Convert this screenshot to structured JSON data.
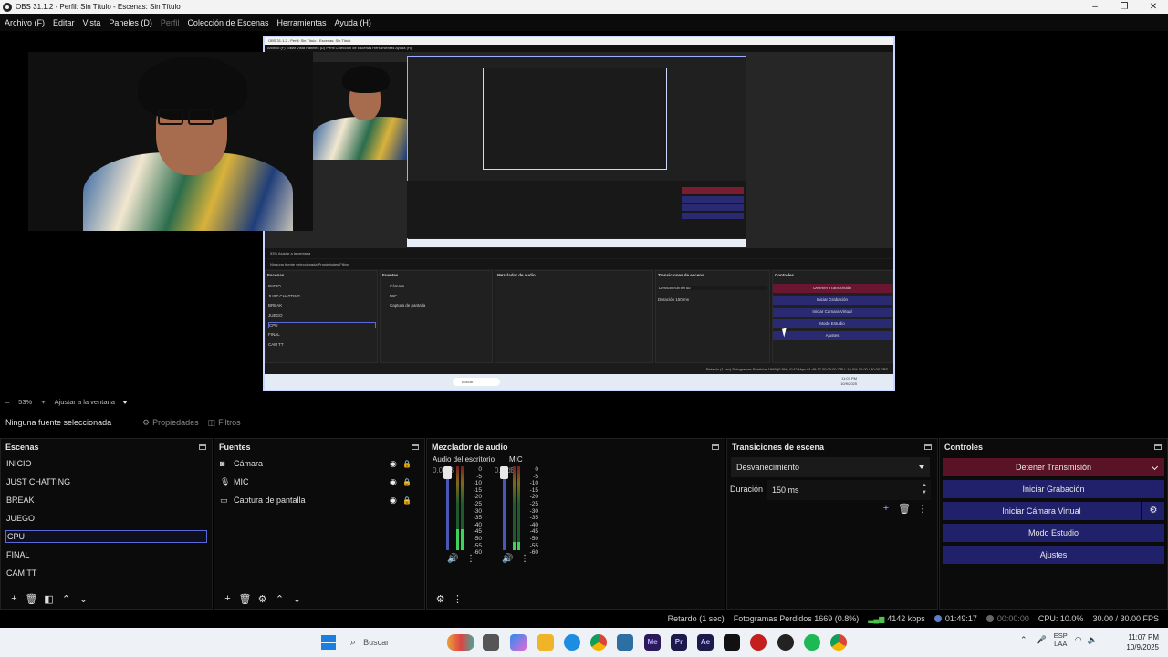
{
  "window": {
    "title": "OBS 31.1.2 - Perfil: Sin Título - Escenas: Sin Título",
    "minimize": "–",
    "maximize": "❐",
    "close": "✕"
  },
  "menu": [
    {
      "label": "Archivo (F)",
      "enabled": true
    },
    {
      "label": "Editar",
      "enabled": true
    },
    {
      "label": "Vista",
      "enabled": true
    },
    {
      "label": "Paneles (D)",
      "enabled": true
    },
    {
      "label": "Perfil",
      "enabled": false
    },
    {
      "label": "Colección de Escenas",
      "enabled": true
    },
    {
      "label": "Herramientas",
      "enabled": true
    },
    {
      "label": "Ayuda (H)",
      "enabled": true
    }
  ],
  "zoom": {
    "minus": "–",
    "value": "53%",
    "plus": "+",
    "fit": "Ajustar a la ventana"
  },
  "source_toolbar": {
    "no_source": "Ninguna fuente seleccionada",
    "properties": "Propiedades",
    "filters": "Filtros"
  },
  "scenes": {
    "title": "Escenas",
    "items": [
      "INICIO",
      "JUST CHATTING",
      "BREAK",
      "JUEGO",
      "CPU",
      "FINAL",
      "CAM TT"
    ],
    "selected": "CPU"
  },
  "sources": {
    "title": "Fuentes",
    "items": [
      {
        "name": "Cámara",
        "icon": "camera-icon"
      },
      {
        "name": "MIC",
        "icon": "microphone-icon"
      },
      {
        "name": "Captura de pantalla",
        "icon": "monitor-icon"
      }
    ]
  },
  "mixer": {
    "title": "Mezclador de audio",
    "channels": [
      {
        "name": "Audio del escritorio",
        "db": "0.0 dB",
        "level": 0.25
      },
      {
        "name": "MIC",
        "db": "0.0 dB",
        "level": 0.1
      }
    ],
    "scale": [
      "0",
      "-5",
      "-10",
      "-15",
      "-20",
      "-25",
      "-30",
      "-35",
      "-40",
      "-45",
      "-50",
      "-55",
      "-60"
    ]
  },
  "transitions": {
    "title": "Transiciones de escena",
    "selected": "Desvanecimiento",
    "duration_label": "Duración",
    "duration_value": "150 ms"
  },
  "controls": {
    "title": "Controles",
    "stop_stream": "Detener Transmisión",
    "start_recording": "Iniciar Grabación",
    "start_virtual_cam": "Iniciar Cámara Virtual",
    "studio_mode": "Modo Estudio",
    "settings": "Ajustes"
  },
  "status": {
    "delay": "Retardo (1 sec)",
    "dropped_frames": "Fotogramas Perdidos 1669 (0.8%)",
    "bitrate": "4142 kbps",
    "stream_time": "01:49:17",
    "record_time": "00:00:00",
    "cpu": "CPU: 10.0%",
    "fps": "30.00 / 30.00 FPS"
  },
  "taskbar": {
    "search": "Buscar",
    "lang_top": "ESP",
    "lang_bottom": "LAA",
    "time": "11:07 PM",
    "date": "10/9/2025"
  },
  "nested": {
    "title": "OBS 31.1.2 - Perfil: Sin Título - Escenas: Sin Título",
    "menu": "Archivo (F)   Editar   Vista   Paneles (D)   Perfil   Colección de Escenas   Herramientas   Ayuda (H)",
    "zoom": "53%    Ajustar a la ventana",
    "no_source": "Ninguna fuente seleccionada      Propiedades                                    Filtros",
    "scenes": [
      "INICIO",
      "JUST CHATTING",
      "BREAK",
      "JUEGO",
      "CPU",
      "FINAL",
      "CAM TT"
    ],
    "sources": [
      "Cámara",
      "MIC",
      "Captura de pantalla"
    ],
    "status": "Retardo (1 sec)   Fotogramas Perdidos 1669 (0.8%)   4142 kbps   01:49:17   00:00:00   CPU: 10.0%   30.00 / 30.00 FPS",
    "buttons": [
      "Detener Transmisión",
      "Iniciar Grabación",
      "Iniciar Cámara Virtual",
      "Modo Estudio",
      "Ajustes"
    ],
    "dock_titles": [
      "Escenas",
      "Fuentes",
      "Mezclador de audio",
      "Transiciones de escena",
      "Controles"
    ],
    "transition": "Desvanecimiento",
    "duration": "Duración     150 ms",
    "search": "Buscar",
    "time": "11:07 PM",
    "date": "10/9/2025"
  }
}
